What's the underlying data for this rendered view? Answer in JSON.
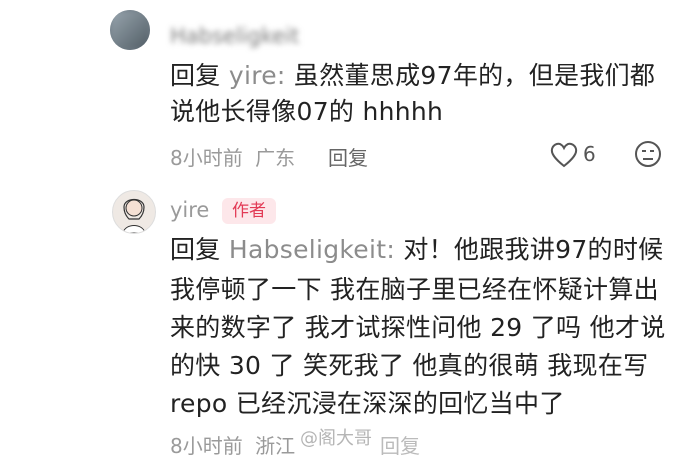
{
  "comments": [
    {
      "author": "Habseligkeit",
      "reply_prefix": "回复",
      "quoted_user": "yire",
      "lines": [
        "虽然董思成97年的，但是我们都",
        "说他长得像07的 hhhhh"
      ],
      "time": "8小时前",
      "location": "广东",
      "reply_label": "回复",
      "like_count": "6"
    },
    {
      "author": "yire",
      "badge": "作者",
      "reply_prefix": "回复",
      "quoted_user": "Habseligkeit",
      "lines": [
        "对！他跟我讲97的时候",
        "我停顿了一下 我在脑子里已经在怀疑计算出",
        "来的数字了 我才试探性问他 29 了吗 他才说",
        "的快 30 了 笑死我了 他真的很萌 我现在写",
        "repo 已经沉浸在深深的回忆当中了"
      ],
      "time": "8小时前",
      "location": "浙江",
      "reply_label": "回复",
      "watermark": "@阁大哥"
    }
  ],
  "colors": {
    "badge_bg": "#fde7ea",
    "badge_text": "#e23a55",
    "meta": "#9a9a9a"
  }
}
